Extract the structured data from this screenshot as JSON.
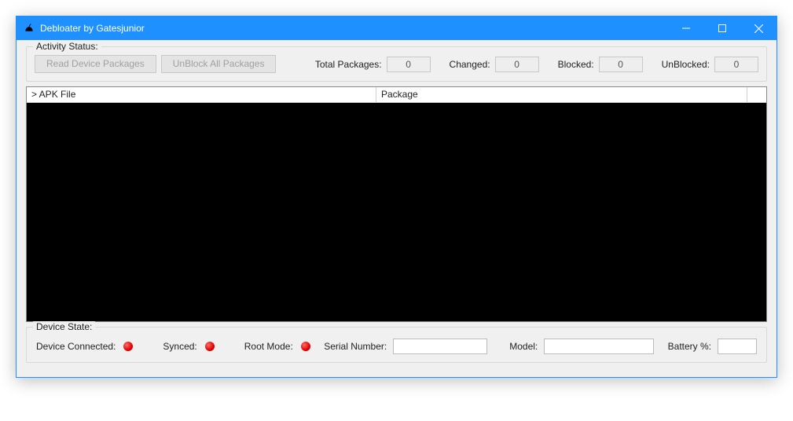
{
  "window": {
    "title": "Debloater by Gatesjunior"
  },
  "activity": {
    "legend": "Activity Status:",
    "buttons": {
      "read": "Read Device Packages",
      "unblock_all": "UnBlock All Packages"
    },
    "labels": {
      "total": "Total Packages:",
      "changed": "Changed:",
      "blocked": "Blocked:",
      "unblocked": "UnBlocked:"
    },
    "values": {
      "total": "0",
      "changed": "0",
      "blocked": "0",
      "unblocked": "0"
    }
  },
  "grid": {
    "col_apk": "> APK File",
    "col_pkg": "Package"
  },
  "device": {
    "legend": "Device State:",
    "labels": {
      "connected": "Device Connected:",
      "synced": "Synced:",
      "root": "Root Mode:",
      "serial": "Serial Number:",
      "model": "Model:",
      "battery": "Battery %:"
    },
    "status": {
      "connected": false,
      "synced": false,
      "root": false
    },
    "values": {
      "serial": "",
      "model": "",
      "battery": ""
    }
  }
}
